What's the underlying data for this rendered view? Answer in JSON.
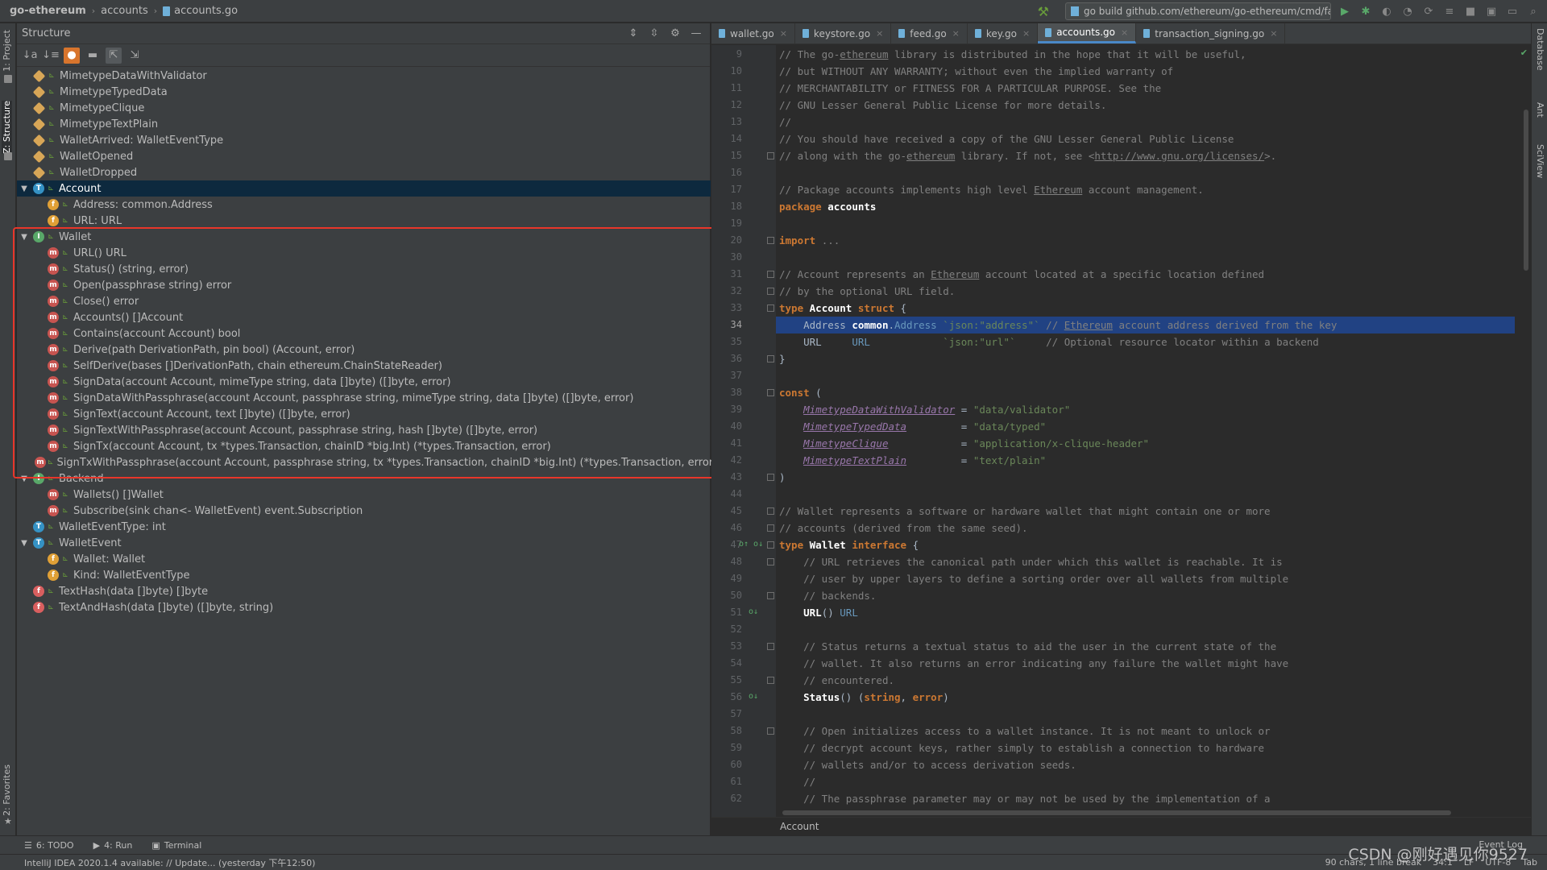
{
  "navbar": {
    "crumbs": [
      "go-ethereum",
      "accounts",
      "accounts.go"
    ],
    "run_config": "go build github.com/ethereum/go-ethereum/cmd/faucet"
  },
  "left_stripe": {
    "project": "1: Project",
    "structure": "Z: Structure",
    "favorites": "2: Favorites"
  },
  "right_stripe": {
    "database": "Database",
    "ant": "Ant",
    "sciview": "SciView"
  },
  "structure": {
    "title": "Structure",
    "items": [
      {
        "icon": "v",
        "label": "MimetypeDataWithValidator",
        "indent": 0
      },
      {
        "icon": "v",
        "label": "MimetypeTypedData",
        "indent": 0
      },
      {
        "icon": "v",
        "label": "MimetypeClique",
        "indent": 0
      },
      {
        "icon": "v",
        "label": "MimetypeTextPlain",
        "indent": 0
      },
      {
        "icon": "v",
        "label": "WalletArrived: WalletEventType",
        "indent": 0
      },
      {
        "icon": "v",
        "label": "WalletOpened",
        "indent": 0
      },
      {
        "icon": "v",
        "label": "WalletDropped",
        "indent": 0
      },
      {
        "icon": "t",
        "label": "Account",
        "indent": 0,
        "expand": true,
        "selected": true
      },
      {
        "icon": "f",
        "label": "Address: common.Address",
        "indent": 1
      },
      {
        "icon": "f",
        "label": "URL: URL",
        "indent": 1
      },
      {
        "icon": "i",
        "label": "Wallet",
        "indent": 0,
        "expand": true
      },
      {
        "icon": "m",
        "label": "URL() URL",
        "indent": 1
      },
      {
        "icon": "m",
        "label": "Status() (string, error)",
        "indent": 1
      },
      {
        "icon": "m",
        "label": "Open(passphrase string) error",
        "indent": 1
      },
      {
        "icon": "m",
        "label": "Close() error",
        "indent": 1
      },
      {
        "icon": "m",
        "label": "Accounts() []Account",
        "indent": 1
      },
      {
        "icon": "m",
        "label": "Contains(account Account) bool",
        "indent": 1
      },
      {
        "icon": "m",
        "label": "Derive(path DerivationPath, pin bool) (Account, error)",
        "indent": 1
      },
      {
        "icon": "m",
        "label": "SelfDerive(bases []DerivationPath, chain ethereum.ChainStateReader)",
        "indent": 1
      },
      {
        "icon": "m",
        "label": "SignData(account Account, mimeType string, data []byte) ([]byte, error)",
        "indent": 1
      },
      {
        "icon": "m",
        "label": "SignDataWithPassphrase(account Account, passphrase string, mimeType string, data []byte) ([]byte, error)",
        "indent": 1
      },
      {
        "icon": "m",
        "label": "SignText(account Account, text []byte) ([]byte, error)",
        "indent": 1
      },
      {
        "icon": "m",
        "label": "SignTextWithPassphrase(account Account, passphrase string, hash []byte) ([]byte, error)",
        "indent": 1
      },
      {
        "icon": "m",
        "label": "SignTx(account Account, tx *types.Transaction, chainID *big.Int) (*types.Transaction, error)",
        "indent": 1
      },
      {
        "icon": "m",
        "label": "SignTxWithPassphrase(account Account, passphrase string, tx *types.Transaction, chainID *big.Int) (*types.Transaction, error)",
        "indent": 1
      },
      {
        "icon": "i",
        "label": "Backend",
        "indent": 0,
        "expand": true
      },
      {
        "icon": "m",
        "label": "Wallets() []Wallet",
        "indent": 1
      },
      {
        "icon": "m",
        "label": "Subscribe(sink chan<- WalletEvent) event.Subscription",
        "indent": 1
      },
      {
        "icon": "t",
        "label": "WalletEventType: int",
        "indent": 0
      },
      {
        "icon": "t",
        "label": "WalletEvent",
        "indent": 0,
        "expand": true
      },
      {
        "icon": "f",
        "label": "Wallet: Wallet",
        "indent": 1
      },
      {
        "icon": "f",
        "label": "Kind: WalletEventType",
        "indent": 1
      },
      {
        "icon": "fn",
        "label": "TextHash(data []byte) []byte",
        "indent": 0
      },
      {
        "icon": "fn",
        "label": "TextAndHash(data []byte) ([]byte, string)",
        "indent": 0
      }
    ]
  },
  "tabs": [
    {
      "label": "wallet.go"
    },
    {
      "label": "keystore.go"
    },
    {
      "label": "feed.go"
    },
    {
      "label": "key.go"
    },
    {
      "label": "accounts.go",
      "active": true
    },
    {
      "label": "transaction_signing.go"
    }
  ],
  "code": {
    "current_line": 34,
    "lines": [
      {
        "n": 9,
        "html": "<span class='c'>// The go-</span><span class='cu'>ethereum</span><span class='c'> library is distributed in the hope that it will be useful,</span>"
      },
      {
        "n": 10,
        "html": "<span class='c'>// but WITHOUT ANY WARRANTY; without even the implied warranty of</span>"
      },
      {
        "n": 11,
        "html": "<span class='c'>// MERCHANTABILITY or FITNESS FOR A PARTICULAR PURPOSE. See the</span>"
      },
      {
        "n": 12,
        "html": "<span class='c'>// GNU Lesser General Public License for more details.</span>"
      },
      {
        "n": 13,
        "html": "<span class='c'>//</span>"
      },
      {
        "n": 14,
        "html": "<span class='c'>// You should have received a copy of the GNU Lesser General Public License</span>"
      },
      {
        "n": 15,
        "html": "<span class='c'>// along with the go-</span><span class='cu'>ethereum</span><span class='c'> library. If not, see &lt;</span><span class='cu'>http://www.gnu.org/licenses/</span><span class='c'>&gt;.</span>",
        "fold": true
      },
      {
        "n": 16,
        "html": ""
      },
      {
        "n": 17,
        "html": "<span class='c'>// Package accounts implements high level </span><span class='cu'>Ethereum</span><span class='c'> account management.</span>"
      },
      {
        "n": 18,
        "html": "<span class='k'>package</span> <span class='wid'>accounts</span>"
      },
      {
        "n": 19,
        "html": ""
      },
      {
        "n": 20,
        "html": "<span class='k'>import</span> <span class='c'>...</span>",
        "fold": true
      },
      {
        "n": 30,
        "html": ""
      },
      {
        "n": 31,
        "html": "<span class='c'>// Account represents an </span><span class='cu'>Ethereum</span><span class='c'> account located at a specific location defined</span>",
        "fold": true
      },
      {
        "n": 32,
        "html": "<span class='c'>// by the optional URL field.</span>",
        "fold": true
      },
      {
        "n": 33,
        "html": "<span class='k'>type</span> <span class='wid'>Account</span> <span class='k'>struct</span> {",
        "fold": true
      },
      {
        "n": 34,
        "html": "    Address <span class='wid'>common</span>.<span class='tyb'>Address</span> <span class='s'>`json:\"address\"`</span> <span class='c'>// </span><span class='cu'>Ethereum</span><span class='c'> account address derived from the key</span>"
      },
      {
        "n": 35,
        "html": "    URL     <span class='tyb'>URL</span>            <span class='s'>`json:\"url\"`</span>     <span class='c'>// Optional resource locator within a backend</span>"
      },
      {
        "n": 36,
        "html": "}",
        "fold": true
      },
      {
        "n": 37,
        "html": ""
      },
      {
        "n": 38,
        "html": "<span class='k'>const</span> (",
        "fold": true
      },
      {
        "n": 39,
        "html": "    <span class='cn'>MimetypeDataWithValidator</span> = <span class='s'>\"data/validator\"</span>"
      },
      {
        "n": 40,
        "html": "    <span class='cn'>MimetypeTypedData</span>         = <span class='s'>\"data/typed\"</span>"
      },
      {
        "n": 41,
        "html": "    <span class='cn'>MimetypeClique</span>            = <span class='s'>\"application/x-clique-header\"</span>"
      },
      {
        "n": 42,
        "html": "    <span class='cn'>MimetypeTextPlain</span>         = <span class='s'>\"text/plain\"</span>"
      },
      {
        "n": 43,
        "html": ")",
        "fold": true
      },
      {
        "n": 44,
        "html": ""
      },
      {
        "n": 45,
        "html": "<span class='c'>// Wallet represents a software or hardware wallet that might contain one or more</span>",
        "fold": true
      },
      {
        "n": 46,
        "html": "<span class='c'>// accounts (derived from the same seed).</span>",
        "fold": true
      },
      {
        "n": 47,
        "html": "<span class='k'>type</span> <span class='wid'>Wallet</span> <span class='k'>interface</span> {",
        "fold": true,
        "mark": "o↑ o↓"
      },
      {
        "n": 48,
        "html": "    <span class='c'>// URL retrieves the canonical path under which this wallet is reachable. It is</span>",
        "fold": true
      },
      {
        "n": 49,
        "html": "    <span class='c'>// user by upper layers to define a sorting order over all wallets from multiple</span>"
      },
      {
        "n": 50,
        "html": "    <span class='c'>// backends.</span>",
        "fold": true
      },
      {
        "n": 51,
        "html": "    <span class='wid'>URL</span>() <span class='tyb'>URL</span>",
        "mark": "o↓"
      },
      {
        "n": 52,
        "html": ""
      },
      {
        "n": 53,
        "html": "    <span class='c'>// Status returns a textual status to aid the user in the current state of the</span>",
        "fold": true
      },
      {
        "n": 54,
        "html": "    <span class='c'>// wallet. It also returns an error indicating any failure the wallet might have</span>"
      },
      {
        "n": 55,
        "html": "    <span class='c'>// encountered.</span>",
        "fold": true
      },
      {
        "n": 56,
        "html": "    <span class='wid'>Status</span>() (<span class='k'>string</span>, <span class='k'>error</span>)",
        "mark": "o↓"
      },
      {
        "n": 57,
        "html": ""
      },
      {
        "n": 58,
        "html": "    <span class='c'>// Open initializes access to a wallet instance. It is not meant to unlock or</span>",
        "fold": true
      },
      {
        "n": 59,
        "html": "    <span class='c'>// decrypt account keys, rather simply to establish a connection to hardware</span>"
      },
      {
        "n": 60,
        "html": "    <span class='c'>// wallets and/or to access derivation seeds.</span>"
      },
      {
        "n": 61,
        "html": "    <span class='c'>//</span>"
      },
      {
        "n": 62,
        "html": "    <span class='c'>// The passphrase parameter may or may not be used by the implementation of a</span>"
      }
    ]
  },
  "editor_breadcrumb": "Account",
  "bottom_tools": {
    "todo": "6: TODO",
    "run": "4: Run",
    "terminal": "Terminal",
    "event_log": "Event Log"
  },
  "status": {
    "message": "IntelliJ IDEA 2020.1.4 available: // Update... (yesterday 下午12:50)",
    "chars": "90 chars, 1 line break",
    "position": "34:1",
    "line_sep": "LF",
    "encoding": "UTF-8",
    "indent": "Tab"
  },
  "watermark": "CSDN @刚好遇见你9527"
}
